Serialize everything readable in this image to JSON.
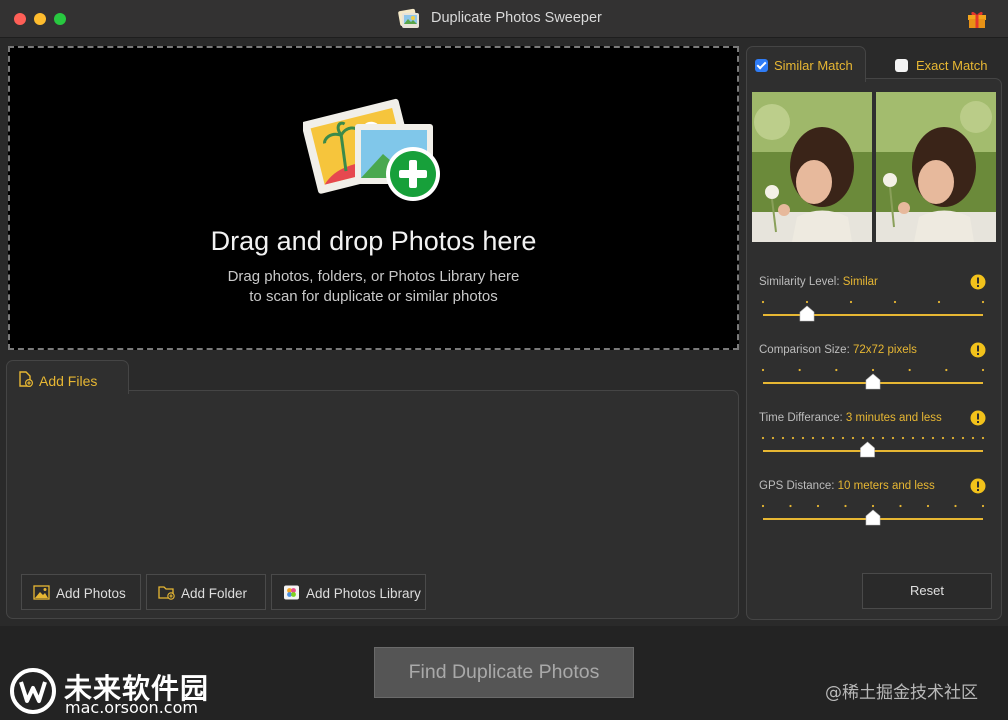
{
  "window": {
    "title": "Duplicate Photos Sweeper"
  },
  "dropzone": {
    "title": "Drag and drop Photos here",
    "subtitle_line1": "Drag photos, folders, or Photos Library here",
    "subtitle_line2": "to scan for duplicate or similar photos"
  },
  "files": {
    "tab_label": "Add Files",
    "buttons": {
      "add_photos": "Add Photos",
      "add_folder": "Add Folder",
      "add_library": "Add Photos Library"
    }
  },
  "match": {
    "similar_label": "Similar Match",
    "similar_checked": true,
    "exact_label": "Exact Match",
    "exact_checked": false
  },
  "settings": {
    "similarity": {
      "label": "Similarity Level: ",
      "value": "Similar",
      "ticks": 6,
      "position": 0.2
    },
    "comparison": {
      "label": "Comparison Size: ",
      "value": "72x72 pixels",
      "ticks": 7,
      "position": 0.5
    },
    "time": {
      "label": "Time Differance: ",
      "value": "3 minutes and less",
      "ticks": 23,
      "position": 0.475
    },
    "gps": {
      "label": "GPS Distance: ",
      "value": "10 meters and less",
      "ticks": 9,
      "position": 0.5
    }
  },
  "reset_label": "Reset",
  "find_label": "Find Duplicate Photos",
  "watermark": {
    "left_cn": "未来软件园",
    "left_url": "mac.orsoon.com",
    "right": "@稀土掘金技术社区"
  },
  "colors": {
    "accent": "#e7b733",
    "checkbox_blue": "#2f7cf6",
    "warning_icon": "#f2c21b"
  }
}
